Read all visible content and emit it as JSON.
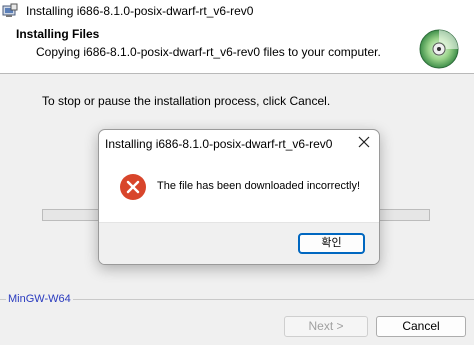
{
  "window": {
    "title": "Installing i686-8.1.0-posix-dwarf-rt_v6-rev0",
    "app_icon": "installer-icon"
  },
  "header": {
    "title": "Installing Files",
    "subtitle": "Copying i686-8.1.0-posix-dwarf-rt_v6-rev0 files to your computer.",
    "icon": "cd-disc-icon"
  },
  "main": {
    "instruction": "To stop or pause the installation process, click Cancel.",
    "progress": 0
  },
  "footer": {
    "brand": "MinGW-W64",
    "next_label": "Next >",
    "cancel_label": "Cancel"
  },
  "dialog": {
    "title": "Installing i686-8.1.0-posix-dwarf-rt_v6-rev0",
    "message": "The file has been downloaded incorrectly!",
    "icon": "error-icon",
    "ok_label": "확인"
  },
  "colors": {
    "error_red": "#d8452b",
    "brand_blue": "#2a3bbf",
    "focus_blue": "#0067c0"
  }
}
